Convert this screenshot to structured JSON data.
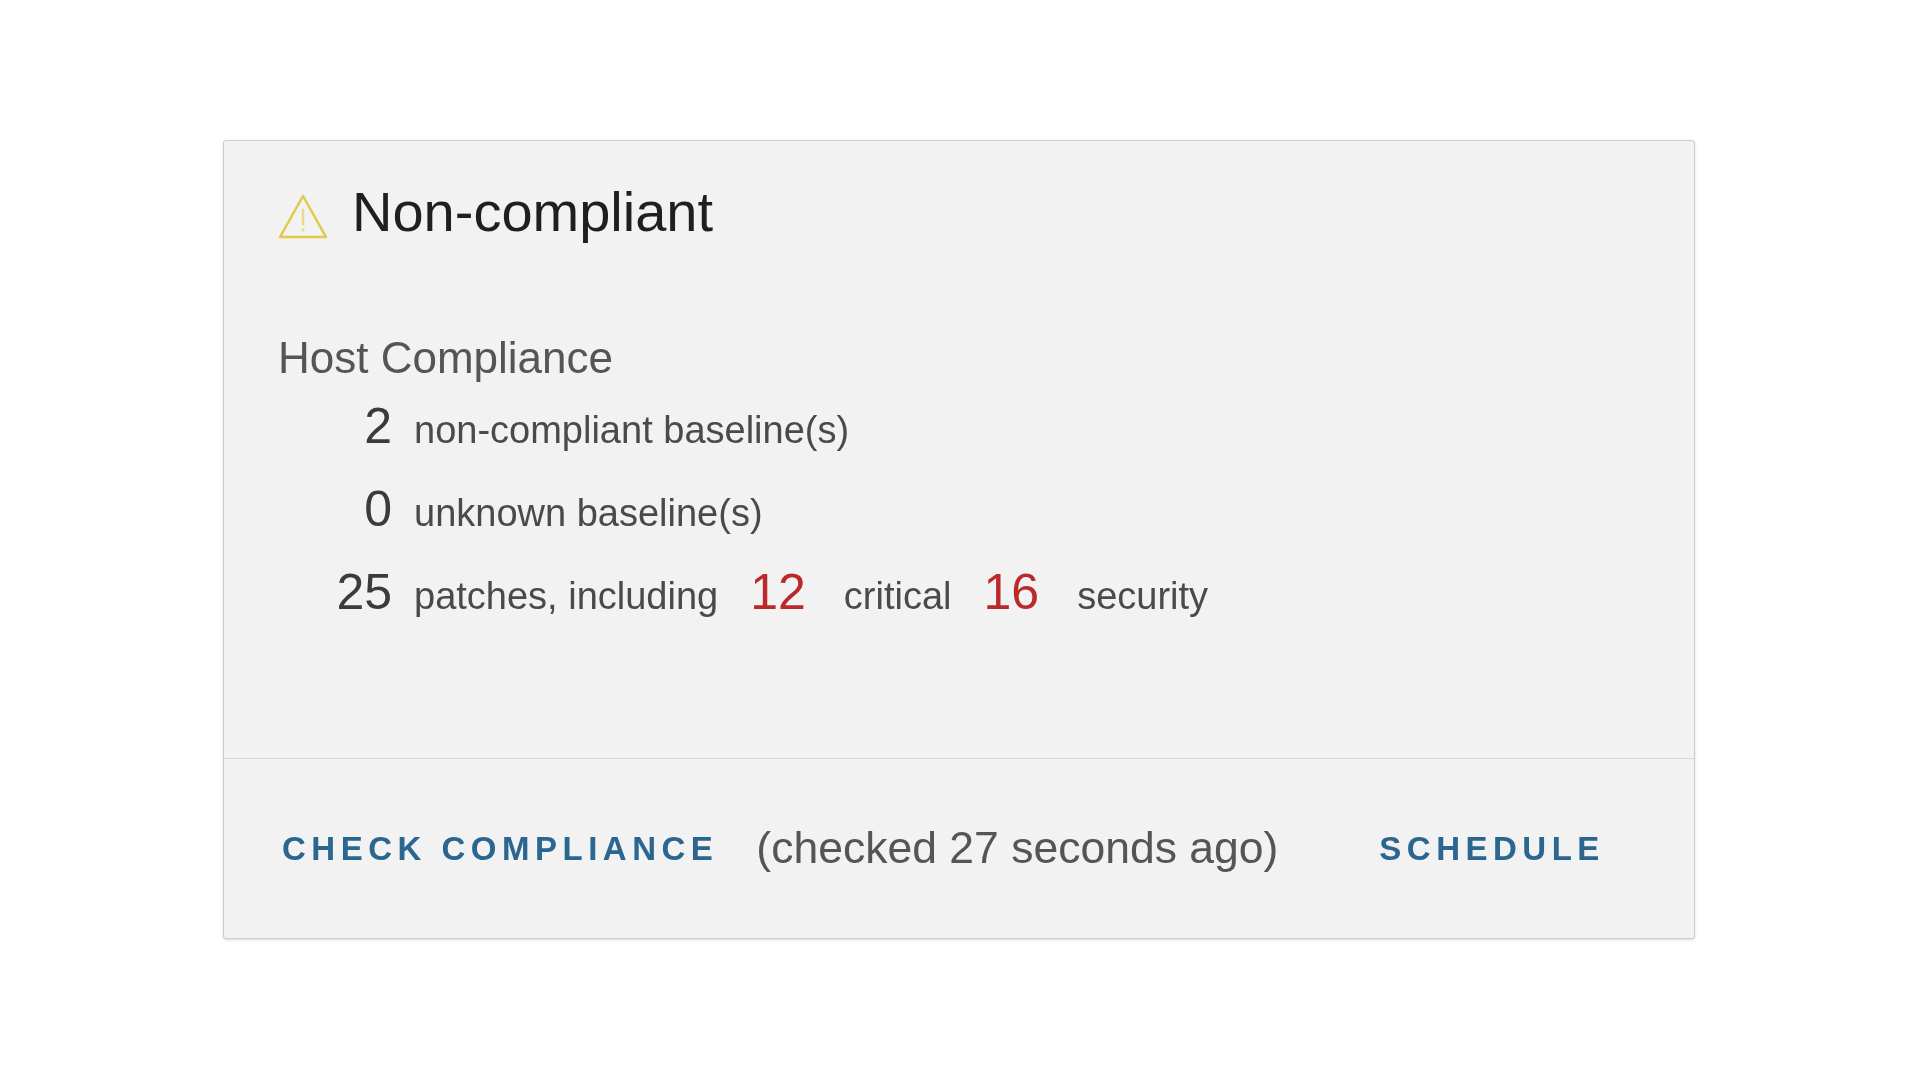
{
  "status": {
    "kind": "warning",
    "label": "Non-compliant"
  },
  "host_compliance": {
    "heading": "Host Compliance",
    "rows": [
      {
        "count": "2",
        "parts": [
          {
            "kind": "label",
            "text": "non-compliant baseline(s)"
          }
        ]
      },
      {
        "count": "0",
        "parts": [
          {
            "kind": "label",
            "text": "unknown baseline(s)"
          }
        ]
      },
      {
        "count": "25",
        "parts": [
          {
            "kind": "label",
            "text": "patches, including"
          },
          {
            "kind": "alert_count",
            "text": "12"
          },
          {
            "kind": "label",
            "text": "critical"
          },
          {
            "kind": "alert_count",
            "text": "16"
          },
          {
            "kind": "label",
            "text": "security"
          }
        ]
      }
    ]
  },
  "footer": {
    "check_button": "CHECK COMPLIANCE",
    "last_checked": "(checked 27 seconds ago)",
    "schedule_button": "SCHEDULE"
  }
}
